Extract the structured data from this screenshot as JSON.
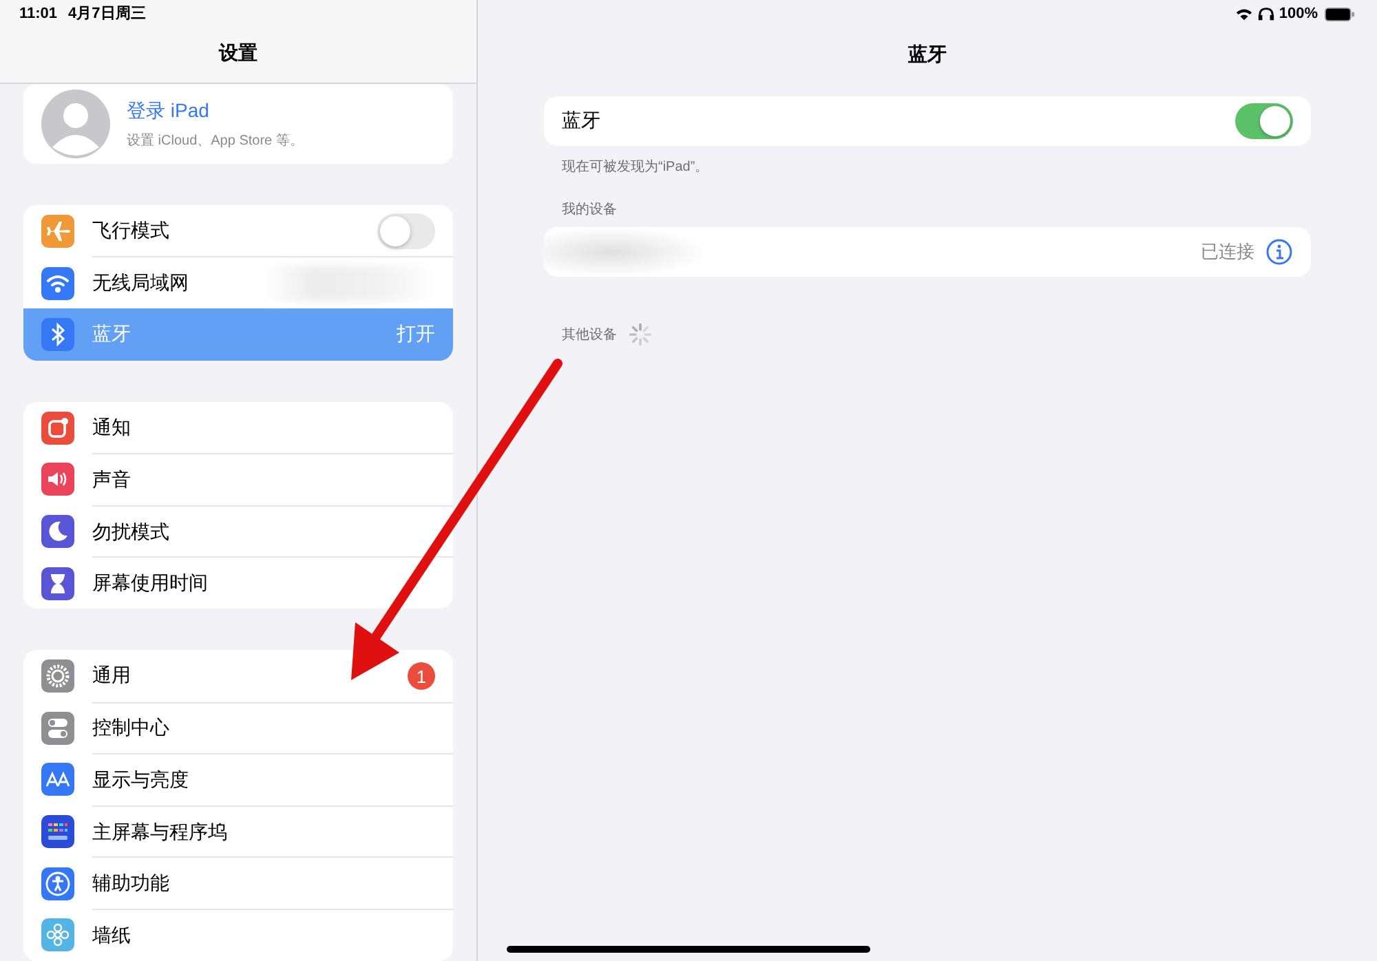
{
  "status_bar": {
    "time": "11:01",
    "date": "4月7日周三",
    "battery": "100%"
  },
  "sidebar": {
    "title": "设置",
    "profile": {
      "name": "登录 iPad",
      "subtitle": "设置 iCloud、App Store 等。"
    },
    "groups": [
      {
        "items": [
          {
            "label": "飞行模式",
            "kind": "toggle",
            "on": false,
            "selected": false,
            "color": "#f09a37"
          },
          {
            "label": "无线局域网",
            "kind": "blurred",
            "selected": false,
            "color": "#3478f6"
          },
          {
            "label": "蓝牙",
            "kind": "value",
            "value": "打开",
            "selected": true,
            "color": "#3478f6"
          }
        ]
      },
      {
        "items": [
          {
            "label": "通知",
            "kind": "plain",
            "selected": false,
            "color": "#eb4d3d"
          },
          {
            "label": "声音",
            "kind": "plain",
            "selected": false,
            "color": "#eb445a"
          },
          {
            "label": "勿扰模式",
            "kind": "plain",
            "selected": false,
            "color": "#5856d6"
          },
          {
            "label": "屏幕使用时间",
            "kind": "plain",
            "selected": false,
            "color": "#5856d6"
          }
        ]
      },
      {
        "items": [
          {
            "label": "通用",
            "kind": "badge",
            "badge": "1",
            "selected": false,
            "color": "#8e8e93"
          },
          {
            "label": "控制中心",
            "kind": "plain",
            "selected": false,
            "color": "#8e8e93"
          },
          {
            "label": "显示与亮度",
            "kind": "plain",
            "selected": false,
            "color": "#3478f6"
          },
          {
            "label": "主屏幕与程序坞",
            "kind": "plain",
            "selected": false,
            "color": "#2c4bd6"
          },
          {
            "label": "辅助功能",
            "kind": "plain",
            "selected": false,
            "color": "#3478f6"
          },
          {
            "label": "墙纸",
            "kind": "plain",
            "selected": false,
            "color": "#54b4e4"
          }
        ]
      }
    ]
  },
  "detail": {
    "title": "蓝牙",
    "bluetooth": {
      "label": "蓝牙",
      "on": true
    },
    "discoverable_note": "现在可被发现为“iPad”。",
    "my_devices": {
      "header": "我的设备",
      "devices": [
        {
          "status": "已连接"
        }
      ]
    },
    "other_devices": {
      "header": "其他设备",
      "searching": true
    }
  },
  "annotation": {
    "kind": "arrow"
  }
}
